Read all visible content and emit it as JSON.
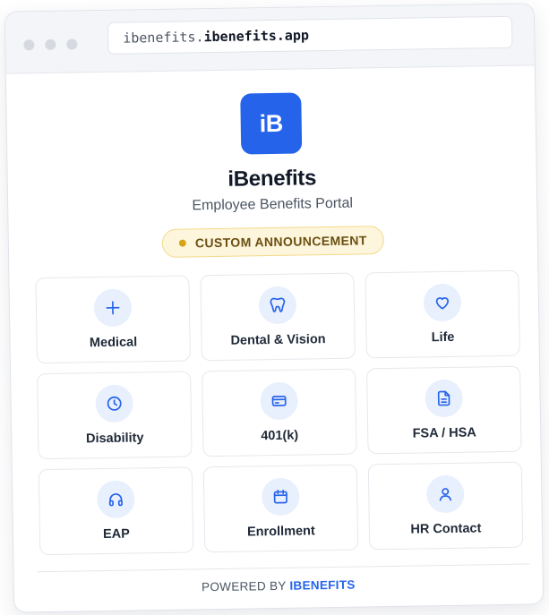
{
  "browser": {
    "url_subdomain": "ibenefits.",
    "url_domain": "ibenefits.app"
  },
  "app": {
    "logo_text": "iB",
    "name": "iBenefits",
    "subtitle": "Employee Benefits Portal",
    "announcement": "CUSTOM ANNOUNCEMENT"
  },
  "tiles": [
    {
      "label": "Medical",
      "icon": "plus-icon"
    },
    {
      "label": "Dental & Vision",
      "icon": "tooth-icon"
    },
    {
      "label": "Life",
      "icon": "heart-icon"
    },
    {
      "label": "Disability",
      "icon": "clock-icon"
    },
    {
      "label": "401(k)",
      "icon": "card-icon"
    },
    {
      "label": "FSA / HSA",
      "icon": "document-icon"
    },
    {
      "label": "EAP",
      "icon": "headphones-icon"
    },
    {
      "label": "Enrollment",
      "icon": "calendar-icon"
    },
    {
      "label": "HR Contact",
      "icon": "user-icon"
    }
  ],
  "footer": {
    "prefix": "POWERED BY",
    "brand": "IBENEFITS"
  },
  "colors": {
    "accent": "#2563eb",
    "announcement_bg": "#fdf6dd",
    "announcement_dot": "#d9a316"
  }
}
